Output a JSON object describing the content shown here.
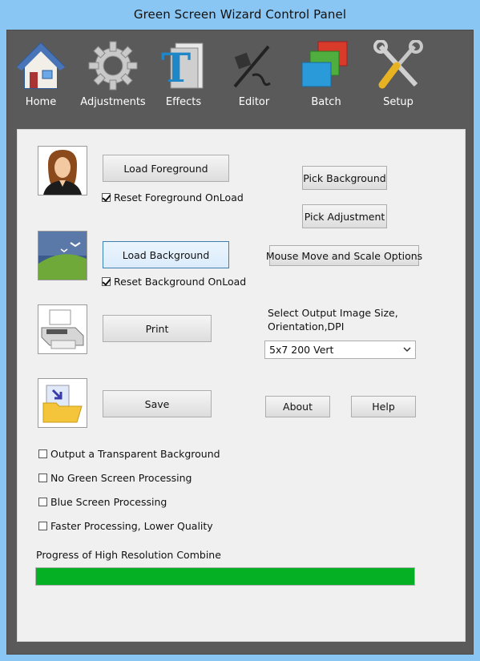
{
  "window": {
    "title": "Green Screen Wizard Control Panel"
  },
  "toolbar": {
    "items": [
      {
        "label": "Home",
        "icon": "home-icon"
      },
      {
        "label": "Adjustments",
        "icon": "gear-icon"
      },
      {
        "label": "Effects",
        "icon": "effects-icon"
      },
      {
        "label": "Editor",
        "icon": "pen-icon"
      },
      {
        "label": "Batch",
        "icon": "layers-icon"
      },
      {
        "label": "Setup",
        "icon": "tools-icon"
      }
    ]
  },
  "foreground": {
    "icon": "person-icon",
    "load_label": "Load Foreground",
    "reset_label": "Reset Foreground OnLoad",
    "reset_checked": true
  },
  "background": {
    "icon": "landscape-icon",
    "load_label": "Load Background",
    "reset_label": "Reset Background OnLoad",
    "reset_checked": true
  },
  "actions": {
    "pick_background": "Pick Background",
    "pick_adjustment": "Pick Adjustment",
    "mouse_options": "Mouse Move and Scale Options",
    "print": "Print",
    "print_icon": "printer-icon",
    "save": "Save",
    "save_icon": "folder-icon",
    "about": "About",
    "help": "Help"
  },
  "output": {
    "size_label_line1": "Select Output Image Size,",
    "size_label_line2": "Orientation,DPI",
    "size_value": "5x7 200 Vert"
  },
  "options": [
    {
      "label": "Output a Transparent Background",
      "checked": false
    },
    {
      "label": "No Green Screen Processing",
      "checked": false
    },
    {
      "label": "Blue Screen Processing",
      "checked": false
    },
    {
      "label": "Faster Processing, Lower Quality",
      "checked": false
    }
  ],
  "progress": {
    "label": "Progress of High Resolution Combine",
    "value": 1.0,
    "color": "#06b025"
  },
  "colors": {
    "titlebar": "#8ac6f3",
    "frame": "#5a5a5a",
    "panel": "#f0f0f0"
  }
}
